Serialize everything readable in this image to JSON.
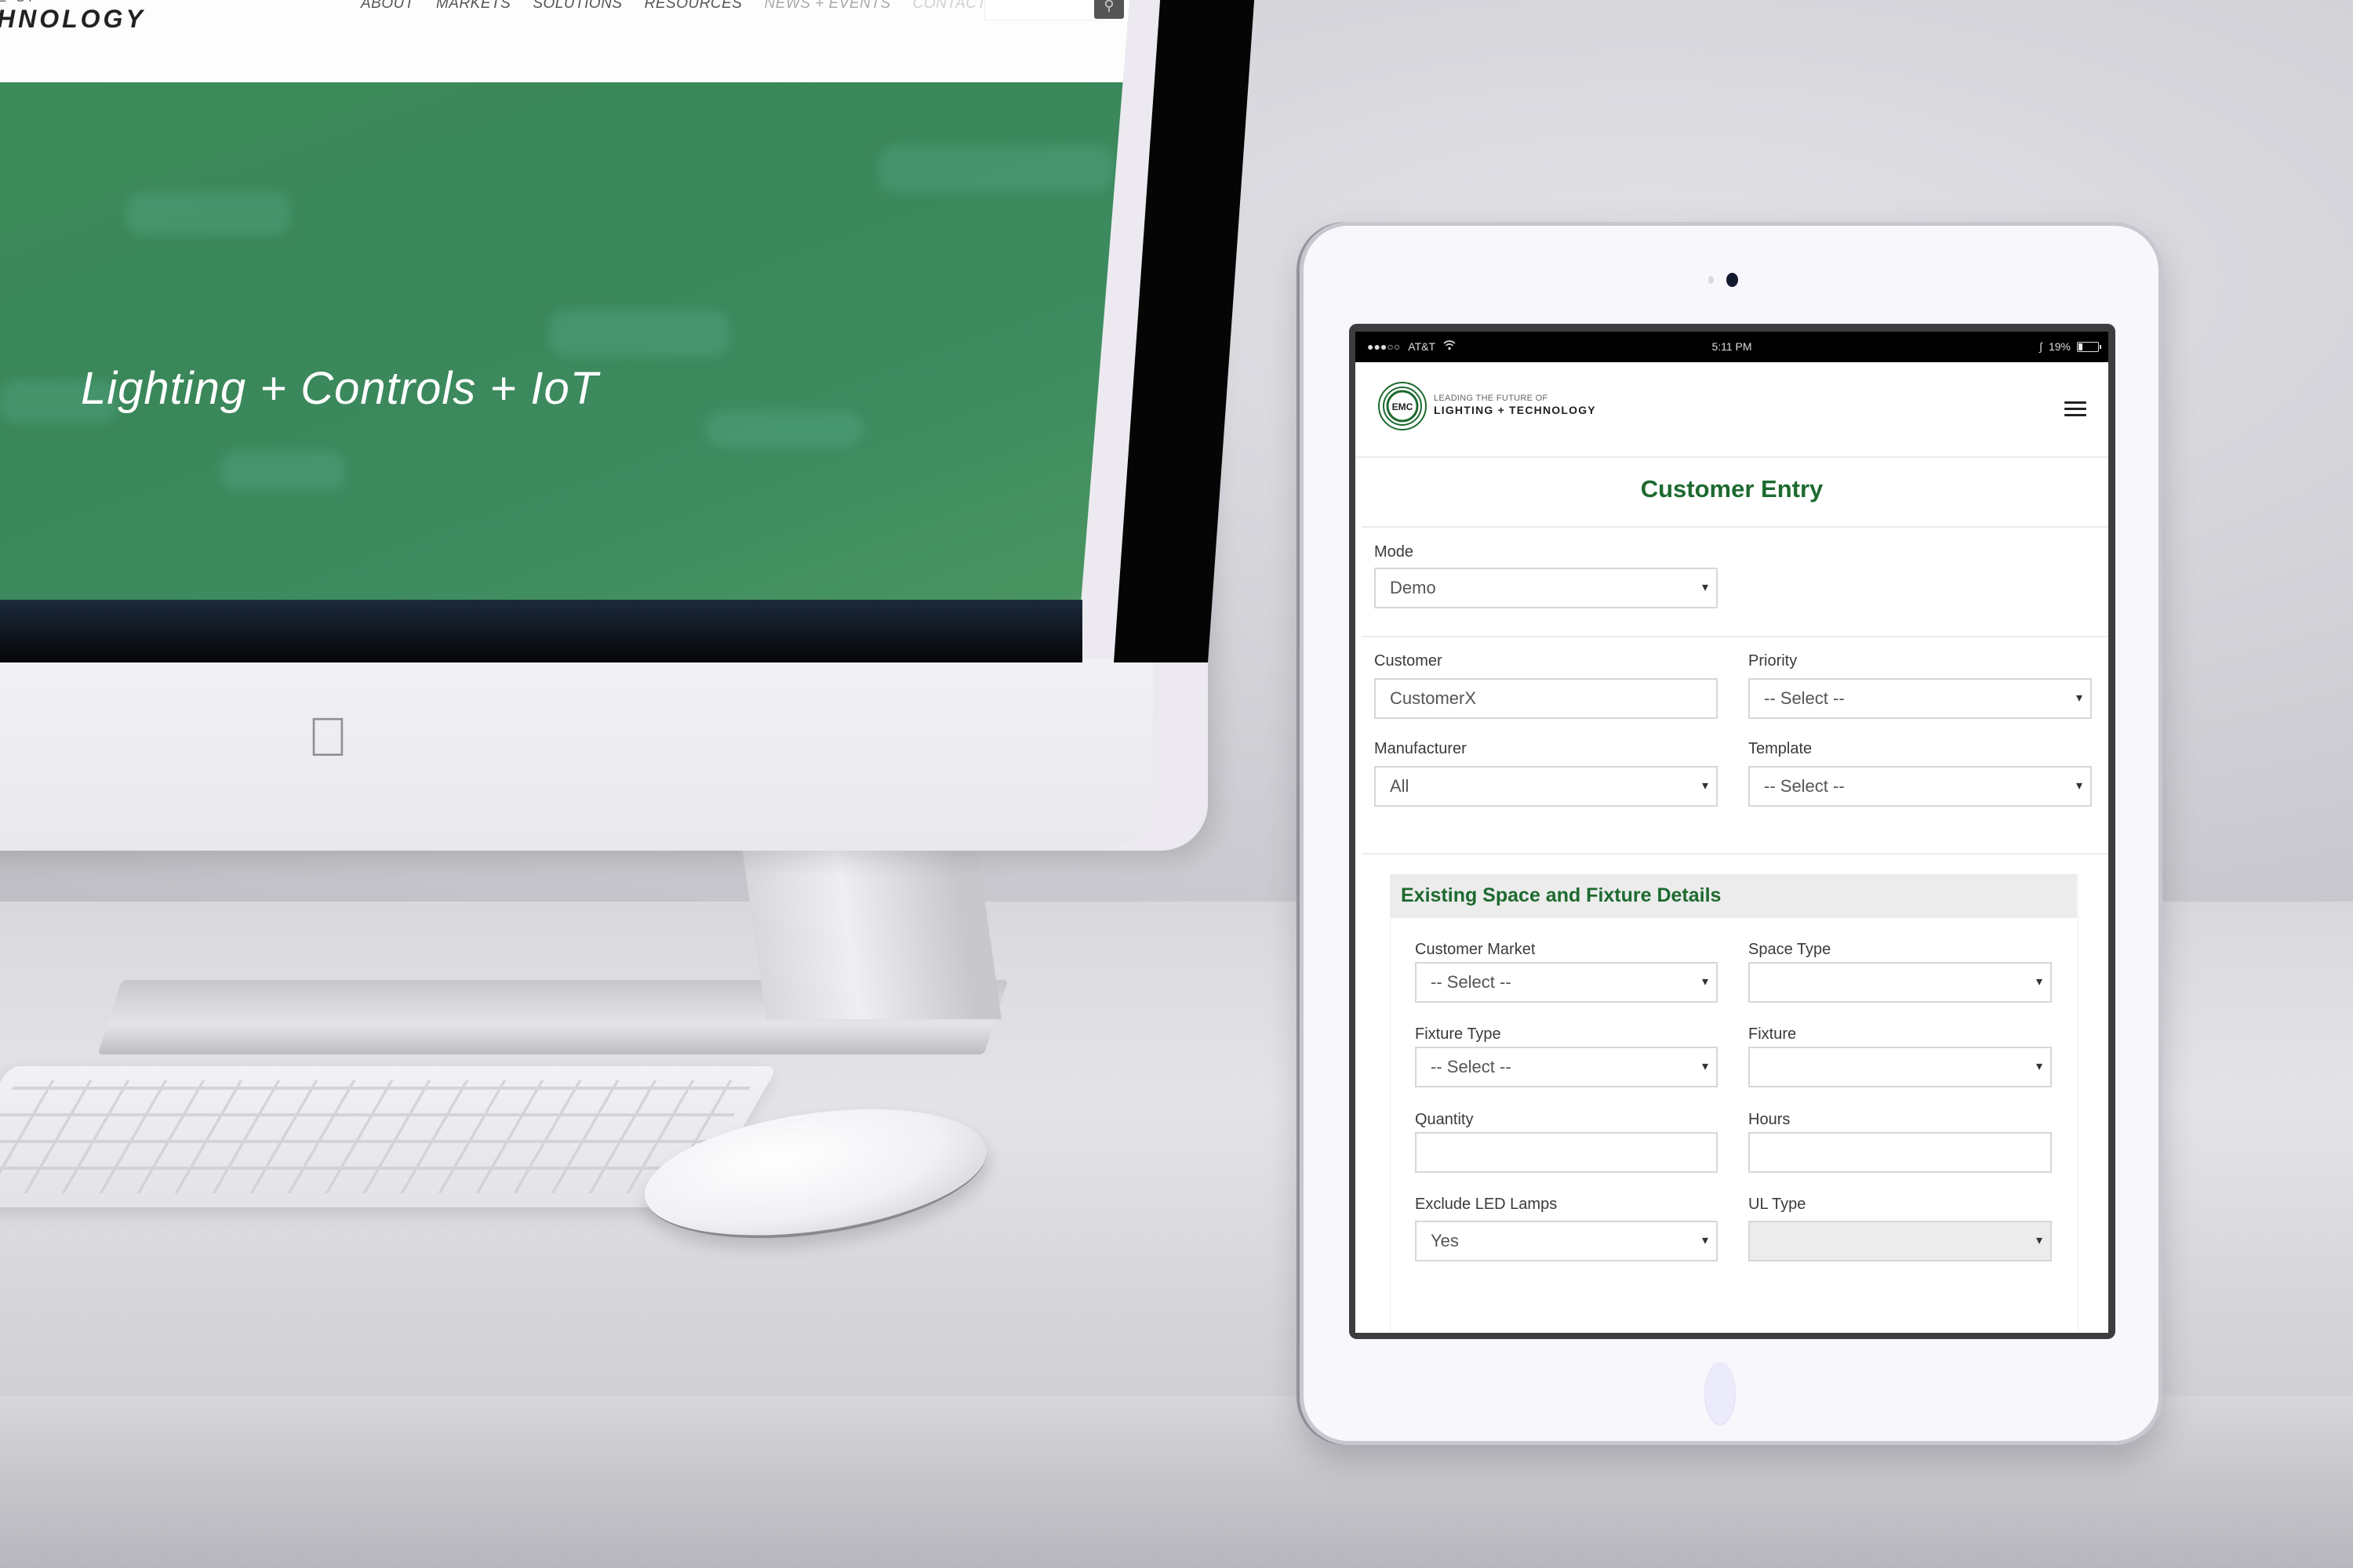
{
  "scene": {
    "description": "Mockup: desktop monitor and tablet showing EMC web app"
  },
  "desktop_site": {
    "logo_partial_top": "E OF",
    "logo_partial": "HNOLOGY",
    "nav": [
      "ABOUT",
      "MARKETS",
      "SOLUTIONS",
      "RESOURCES",
      "NEWS + EVENTS",
      "CONTACT"
    ],
    "search_icon": "search-icon",
    "hero_title": "Lighting + Controls + IoT",
    "hero_color": "#3d8a5a"
  },
  "tablet": {
    "status_bar": {
      "signal": "●●●○○",
      "carrier": "AT&T",
      "wifi_icon": "wifi-icon",
      "time": "5:11 PM",
      "bluetooth_icon": "bluetooth-icon",
      "battery_percent": "19%",
      "battery_level": 0.19
    },
    "header": {
      "logo_mark": "EMC",
      "logo_line1": "LEADING THE FUTURE OF",
      "logo_line2": "LIGHTING + TECHNOLOGY",
      "menu_icon": "hamburger-menu-icon"
    },
    "page_title": "Customer Entry",
    "brand_color": "#1d6a2f",
    "form": {
      "mode": {
        "label": "Mode",
        "value": "Demo"
      },
      "customer": {
        "label": "Customer",
        "value": "CustomerX"
      },
      "priority": {
        "label": "Priority",
        "value": "-- Select --"
      },
      "manufacturer": {
        "label": "Manufacturer",
        "value": "All"
      },
      "template": {
        "label": "Template",
        "value": "-- Select --"
      }
    },
    "section": {
      "title": "Existing Space and Fixture Details",
      "customer_market": {
        "label": "Customer Market",
        "value": "-- Select --"
      },
      "space_type": {
        "label": "Space Type",
        "value": ""
      },
      "fixture_type": {
        "label": "Fixture Type",
        "value": "-- Select --"
      },
      "fixture": {
        "label": "Fixture",
        "value": ""
      },
      "quantity": {
        "label": "Quantity",
        "value": ""
      },
      "hours": {
        "label": "Hours",
        "value": ""
      },
      "exclude_led_lamps": {
        "label": "Exclude LED Lamps",
        "value": "Yes"
      },
      "ul_type": {
        "label": "UL Type",
        "value": "",
        "disabled": true
      }
    }
  }
}
